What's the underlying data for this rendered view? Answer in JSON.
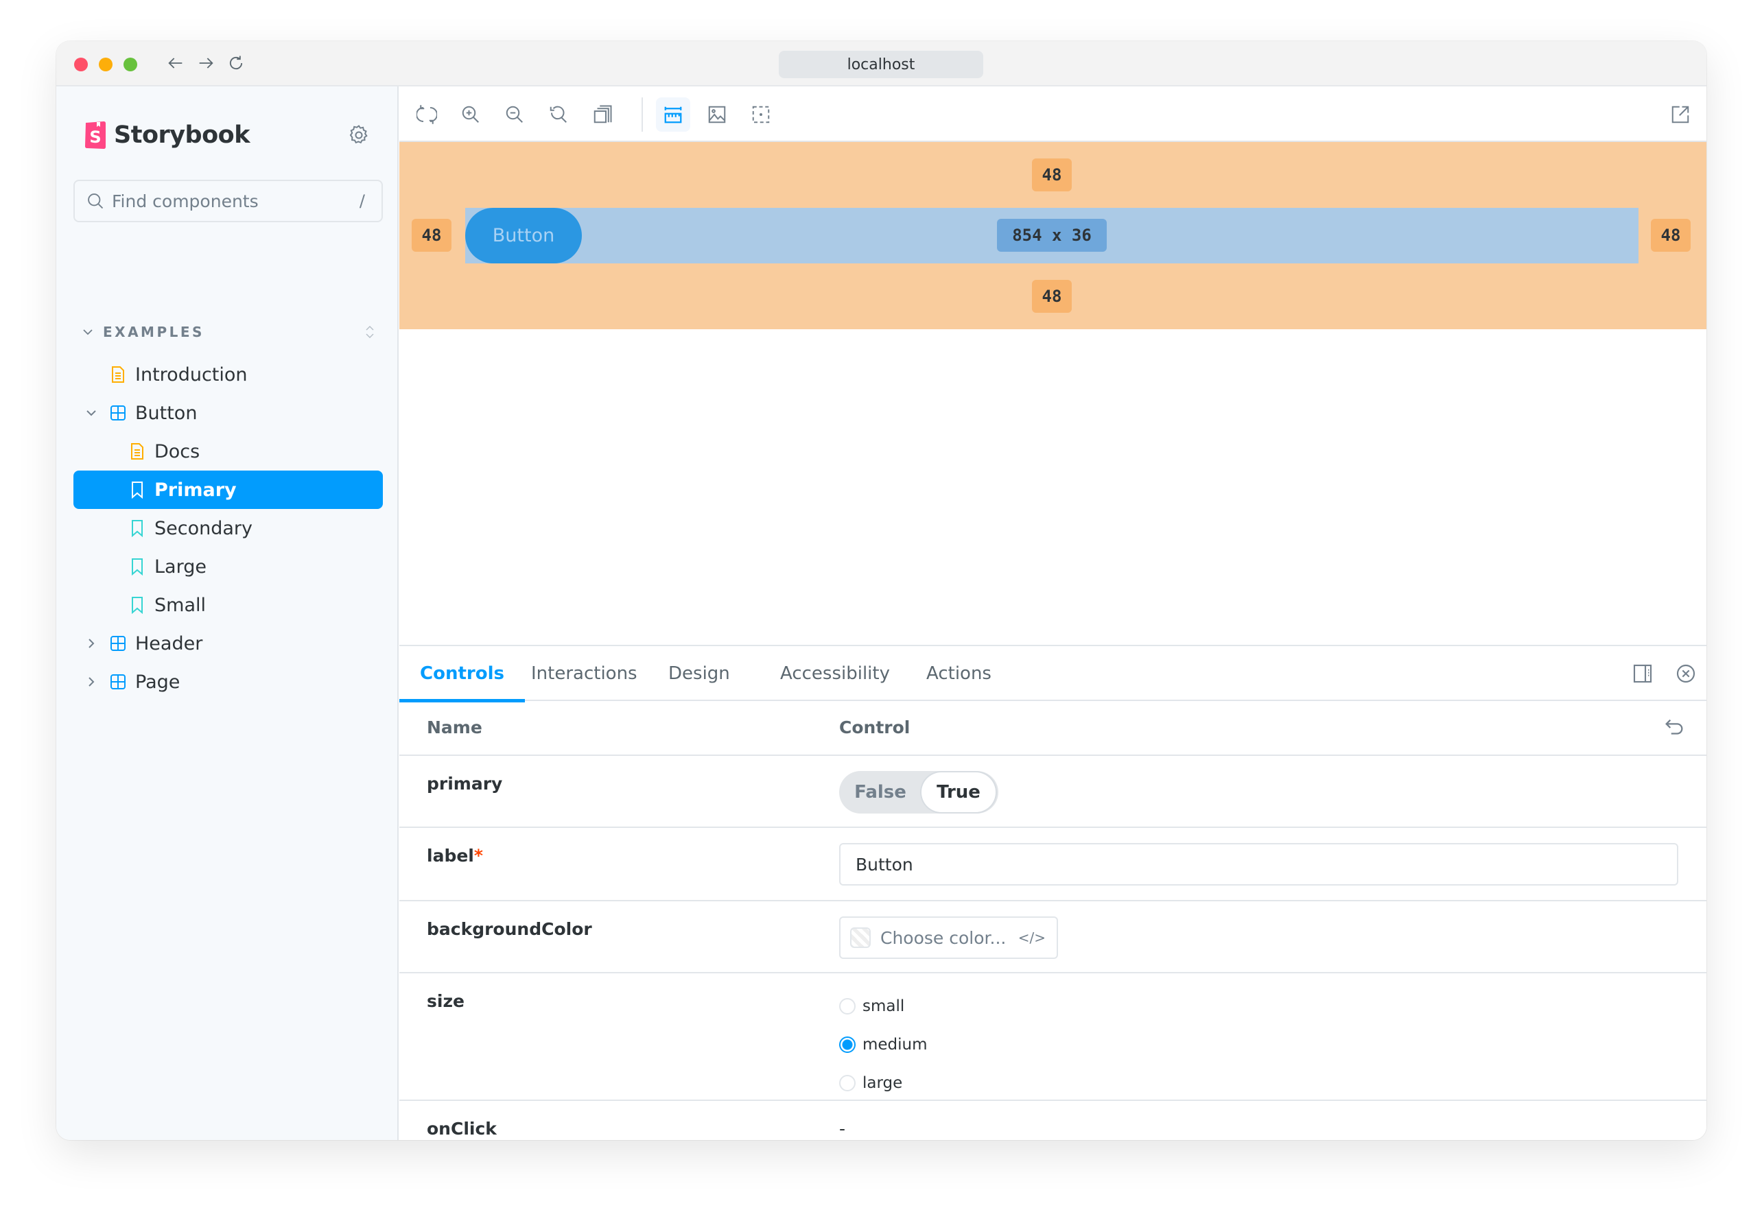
{
  "browser": {
    "url": "localhost",
    "back_icon": "arrow-left-icon",
    "forward_icon": "arrow-right-icon",
    "reload_icon": "reload-icon"
  },
  "sidebar": {
    "brand": "Storybook",
    "settings_icon": "gear-icon",
    "search": {
      "placeholder": "Find components",
      "shortcut": "/"
    },
    "section": {
      "title": "EXAMPLES"
    },
    "items": [
      {
        "label": "Introduction",
        "type": "docs",
        "depth": 1
      },
      {
        "label": "Button",
        "type": "component",
        "depth": 1,
        "expanded": true
      },
      {
        "label": "Docs",
        "type": "docs",
        "depth": 2
      },
      {
        "label": "Primary",
        "type": "story",
        "depth": 2,
        "selected": true
      },
      {
        "label": "Secondary",
        "type": "story",
        "depth": 2
      },
      {
        "label": "Large",
        "type": "story",
        "depth": 2
      },
      {
        "label": "Small",
        "type": "story",
        "depth": 2
      },
      {
        "label": "Header",
        "type": "component",
        "depth": 1,
        "expanded": false
      },
      {
        "label": "Page",
        "type": "component",
        "depth": 1,
        "expanded": false
      }
    ]
  },
  "toolbar": {
    "buttons": [
      {
        "name": "remount-button",
        "icon": "sync-icon"
      },
      {
        "name": "zoom-in-button",
        "icon": "zoom-in-icon"
      },
      {
        "name": "zoom-out-button",
        "icon": "zoom-out-icon"
      },
      {
        "name": "zoom-reset-button",
        "icon": "zoom-reset-icon"
      },
      {
        "name": "viewport-button",
        "icon": "viewport-icon"
      },
      {
        "name": "measure-button",
        "icon": "ruler-icon",
        "active": true
      },
      {
        "name": "backgrounds-button",
        "icon": "photo-icon"
      },
      {
        "name": "outline-button",
        "icon": "outline-icon"
      }
    ],
    "open_new_tab_icon": "share-alt-icon"
  },
  "canvas": {
    "button_label": "Button",
    "measure": {
      "margin_top": "48",
      "margin_bottom": "48",
      "margin_left": "48",
      "margin_right": "48",
      "dimensions": "854 x 36"
    }
  },
  "panel": {
    "tabs": [
      {
        "label": "Controls",
        "active": true
      },
      {
        "label": "Interactions"
      },
      {
        "label": "Design"
      },
      {
        "label": "Accessibility"
      },
      {
        "label": "Actions"
      }
    ],
    "header": {
      "name": "Name",
      "control": "Control"
    },
    "rows": {
      "primary": {
        "name": "primary",
        "false_label": "False",
        "true_label": "True",
        "value": true
      },
      "label": {
        "name": "label",
        "required_mark": "*",
        "value": "Button"
      },
      "backgroundColor": {
        "name": "backgroundColor",
        "placeholder": "Choose color...",
        "code_icon": "</>"
      },
      "size": {
        "name": "size",
        "options": [
          "small",
          "medium",
          "large"
        ],
        "selected": "medium"
      },
      "onClick": {
        "name": "onClick",
        "value": "-"
      }
    }
  },
  "colors": {
    "accent": "#029cfd",
    "margin_overlay": "#f9cc9d",
    "content_overlay": "#abcae6",
    "brand_pink": "#ff4785"
  }
}
